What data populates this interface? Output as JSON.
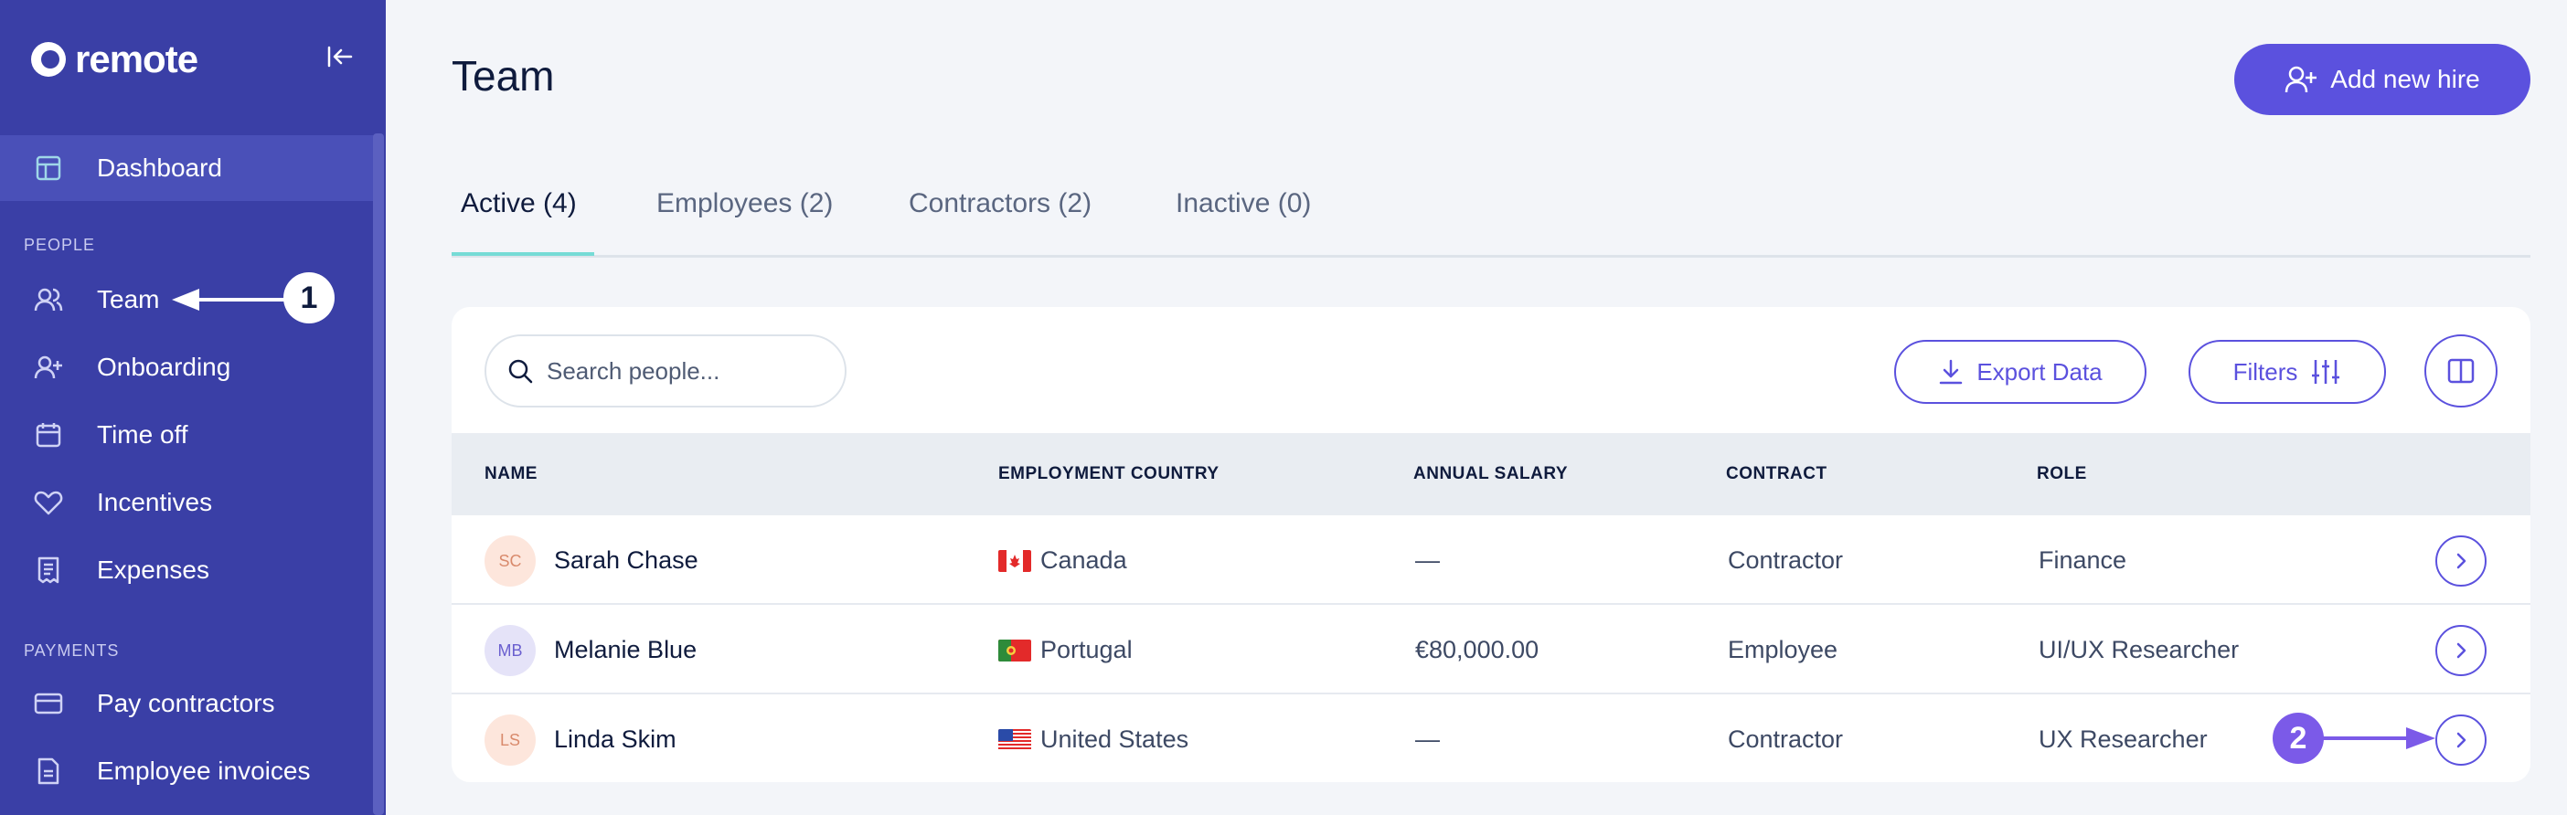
{
  "app": {
    "logo_text": "remote"
  },
  "sidebar": {
    "dashboard": "Dashboard",
    "sections": {
      "people": "PEOPLE",
      "payments": "PAYMENTS"
    },
    "people_items": [
      "Team",
      "Onboarding",
      "Time off",
      "Incentives",
      "Expenses"
    ],
    "payment_items": [
      "Pay contractors",
      "Employee invoices"
    ]
  },
  "header": {
    "title": "Team",
    "add_button": "Add new hire"
  },
  "tabs": [
    "Active (4)",
    "Employees (2)",
    "Contractors (2)",
    "Inactive (0)"
  ],
  "toolbar": {
    "search_placeholder": "Search people...",
    "export_label": "Export Data",
    "filters_label": "Filters"
  },
  "table": {
    "headers": [
      "NAME",
      "EMPLOYMENT COUNTRY",
      "ANNUAL SALARY",
      "CONTRACT",
      "ROLE"
    ],
    "rows": [
      {
        "initials": "SC",
        "name": "Sarah Chase",
        "country": "Canada",
        "salary": "—",
        "contract": "Contractor",
        "role": "Finance"
      },
      {
        "initials": "MB",
        "name": "Melanie Blue",
        "country": "Portugal",
        "salary": "€80,000.00",
        "contract": "Employee",
        "role": "UI/UX Researcher"
      },
      {
        "initials": "LS",
        "name": "Linda Skim",
        "country": "United States",
        "salary": "—",
        "contract": "Contractor",
        "role": "UX Researcher"
      }
    ]
  },
  "annotations": {
    "step1": "1",
    "step2": "2"
  },
  "colors": {
    "sidebar": "#3a3fa6",
    "accent": "#5b51de",
    "tab_underline": "#76dbd6"
  }
}
